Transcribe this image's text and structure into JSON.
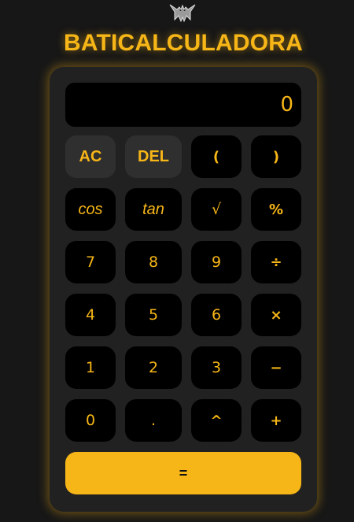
{
  "app": {
    "title": "BATICALCULADORA",
    "logo_icon": "bat-logo-icon"
  },
  "display": {
    "value": "0"
  },
  "buttons": {
    "ac": "AC",
    "del": "DEL",
    "open_paren": "(",
    "close_paren": ")",
    "cos": "cos",
    "tan": "tan",
    "sqrt": "√",
    "percent": "%",
    "seven": "7",
    "eight": "8",
    "nine": "9",
    "divide": "÷",
    "four": "4",
    "five": "5",
    "six": "6",
    "multiply": "×",
    "one": "1",
    "two": "2",
    "three": "3",
    "minus": "−",
    "zero": "0",
    "dot": ".",
    "power": "^",
    "plus": "+",
    "equals": "="
  },
  "colors": {
    "accent": "#f7b617",
    "background": "#171717",
    "panel": "#212121",
    "key": "#000000",
    "function_key": "#2f2f2f"
  }
}
